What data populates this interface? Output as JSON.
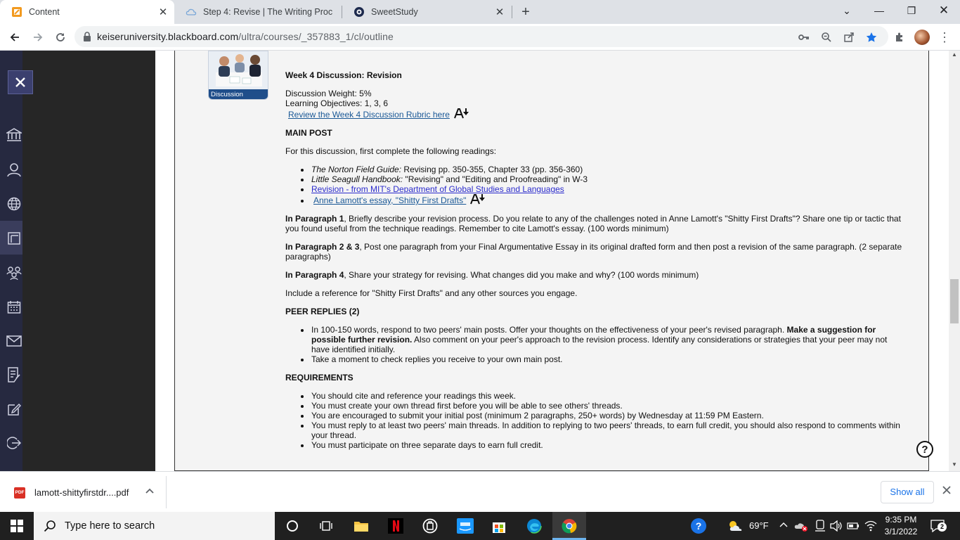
{
  "browser": {
    "tabs": [
      {
        "title": "Content",
        "active": true
      },
      {
        "title": "Step 4: Revise | The Writing Proc",
        "active": false
      },
      {
        "title": "SweetStudy",
        "active": false
      }
    ],
    "new_tab": "+",
    "url_host": "keiseruniversity.blackboard.com",
    "url_path": "/ultra/courses/_357883_1/cl/outline"
  },
  "discussion_badge": "Discussion",
  "post": {
    "title": "Week 4 Discussion: Revision",
    "weight": "Discussion Weight: 5%",
    "objectives": "Learning Objectives: 1, 3, 6",
    "rubric_link": "Review the Week 4 Discussion Rubric here",
    "main_post_heading": "MAIN POST",
    "intro": "For this discussion, first complete the following readings:",
    "readings": [
      {
        "italic": "The Norton Field Guide:",
        "text": " Revising pp. 350-355, Chapter 33 (pp. 356-360)"
      },
      {
        "italic": "Little Seagull Handbook:",
        "text": " \"Revising\" and \"Editing and Proofreading\" in W-3"
      }
    ],
    "reading_link_1": "Revision - from MIT's Department of Global Studies and Languages",
    "reading_link_2": "Anne Lamott's essay, \"Shitty First Drafts\"",
    "p1_bold": "In Paragraph 1",
    "p1_line1": ",  Briefly describe your revision process. Do you relate to any of the challenges noted in Anne Lamott's \"Shitty First Drafts\"? Share one tip or tactic that",
    "p1_line2": "you found useful from the technique readings. Remember to cite Lamott's essay. (100 words minimum)",
    "p2_bold": "In Paragraph 2 & 3",
    "p2_line1": ", Post one paragraph from your Final Argumentative Essay in its original drafted form and then post a revision of the same paragraph. (2 separate",
    "p2_line2": "paragraphs)",
    "p4_bold": "In Paragraph 4",
    "p4_text": ", Share your strategy for revising. What changes did you make and why? (100 words minimum)",
    "reference_note": "Include a reference for \"Shitty First Drafts\" and any other sources you engage.",
    "peer_heading": "PEER REPLIES (2)",
    "peer_1_line1": "In 100-150 words, respond to two peers' main posts.  Offer your thoughts on the effectiveness of your peer's revised paragraph. ",
    "peer_1_bold1": "Make a suggestion for",
    "peer_1_bold2": "possible further revision.",
    "peer_1_line2": "  Also comment on your peer's approach to the revision process. Identify any considerations or strategies that your peer may not",
    "peer_1_line3": "have identified initially.",
    "peer_2": "Take a moment to check replies you receive to your own main post.",
    "req_heading": "REQUIREMENTS",
    "req_1": "You should cite and reference your readings this week.",
    "req_2": "You must create your own thread first before you will be able to see others' threads.",
    "req_3": "You are encouraged to submit your initial post (minimum 2 paragraphs, 250+ words) by Wednesday at 11:59 PM Eastern.",
    "req_4_line1": "You must reply to at least two peers' main threads. In addition to replying to two peers' threads, to earn full credit, you should also respond to comments within",
    "req_4_line2": "your thread.",
    "req_5": "You must participate on three separate days to earn full credit."
  },
  "download": {
    "file": "lamott-shittyfirstdr....pdf",
    "badge": "PDF",
    "show_all": "Show all"
  },
  "taskbar": {
    "search_placeholder": "Type here to search",
    "weather": "69°F",
    "time": "9:35 PM",
    "date": "3/1/2022",
    "notifications": "2"
  },
  "colors": {
    "nav": "#262940",
    "link": "#1a5896",
    "accent": "#1a73e8"
  }
}
